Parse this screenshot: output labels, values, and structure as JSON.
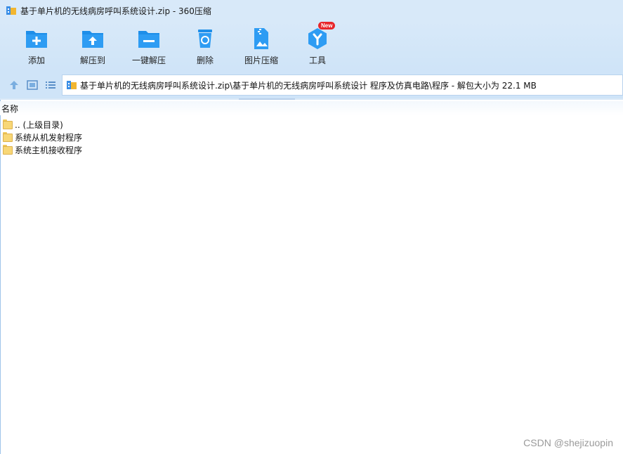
{
  "window": {
    "title": "基于单片机的无线病房呼叫系统设计.zip - 360压缩",
    "app_icon": "archive-icon"
  },
  "toolbar": {
    "buttons": [
      {
        "label": "添加",
        "icon": "add-folder-icon"
      },
      {
        "label": "解压到",
        "icon": "extract-to-icon"
      },
      {
        "label": "一键解压",
        "icon": "one-click-extract-icon"
      },
      {
        "label": "删除",
        "icon": "recycle-bin-icon"
      },
      {
        "label": "图片压缩",
        "icon": "image-compress-icon"
      },
      {
        "label": "工具",
        "icon": "tools-icon",
        "badge": "New"
      }
    ]
  },
  "addressbar": {
    "path": "基于单片机的无线病房呼叫系统设计.zip\\基于单片机的无线病房呼叫系统设计 程序及仿真电路\\程序 - 解包大小为 22.1 MB"
  },
  "filelist": {
    "column_name": "名称",
    "items": [
      {
        "name": ".. (上级目录)",
        "icon": "folder-icon"
      },
      {
        "name": "系统从机发射程序",
        "icon": "folder-icon"
      },
      {
        "name": "系统主机接收程序",
        "icon": "folder-icon"
      }
    ]
  },
  "watermark": "CSDN @shejizuopin",
  "colors": {
    "toolbar_bg": "#d8e9f9",
    "icon_blue": "#1e8ee9",
    "badge_red": "#e8262a",
    "folder_yellow": "#f8d776"
  }
}
